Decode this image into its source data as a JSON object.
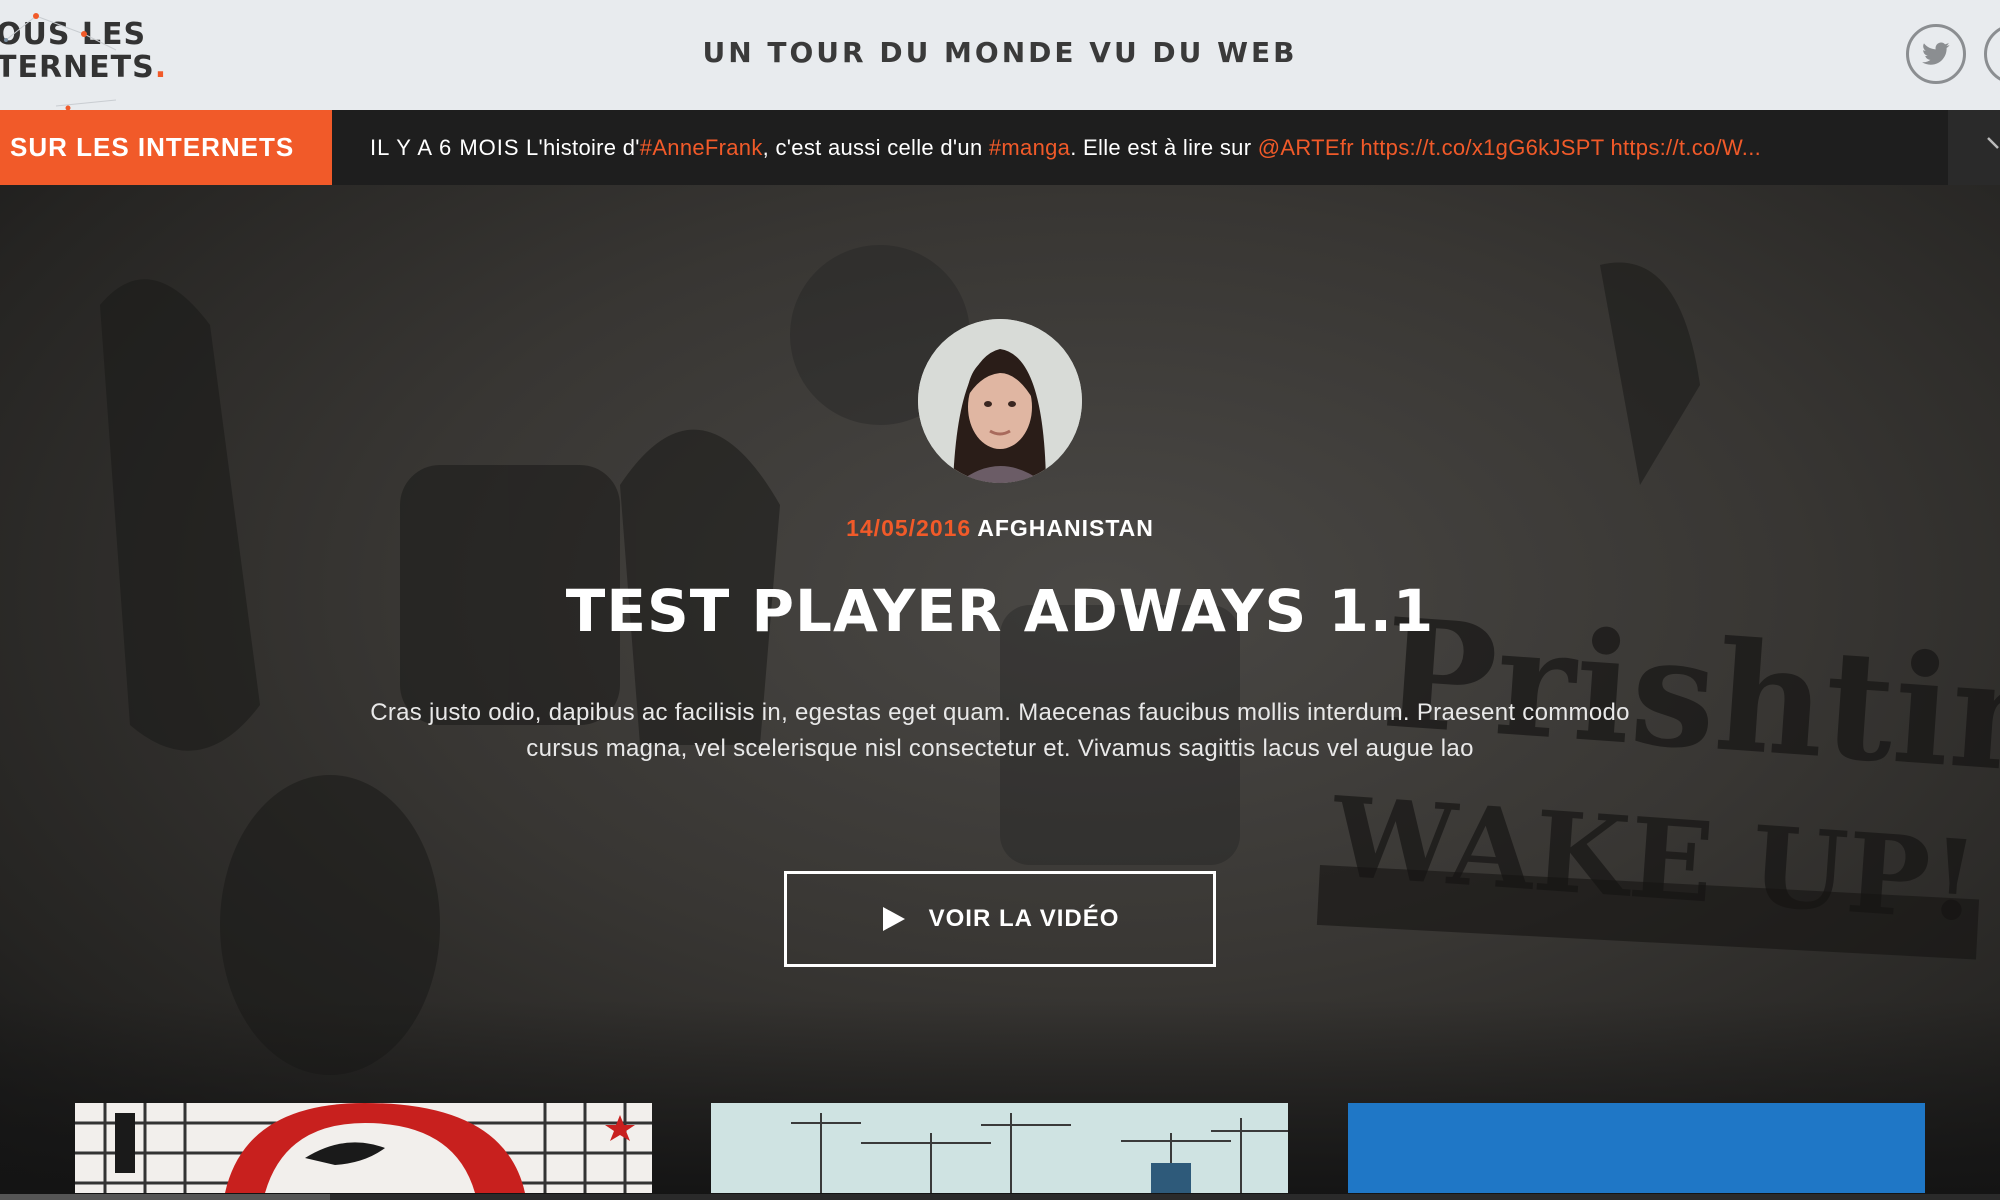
{
  "header": {
    "logo_line1": "OUS LES",
    "logo_line2": "TERNETS",
    "logo_dot": ".",
    "site_title": "UN TOUR DU MONDE VU DU WEB",
    "social_icons": [
      "twitter-icon",
      "social-icon"
    ]
  },
  "ticker": {
    "label": "SUR LES INTERNETS",
    "time": "IL Y A 6 MOIS",
    "text_1": " L'histoire d'",
    "tag_1": "#AnneFrank",
    "text_2": ", c'est aussi celle d'un ",
    "tag_2": "#manga",
    "text_3": ". Elle est à lire sur ",
    "link_1": "@ARTEfr https://t.co/x1gG6kJSPT https://t.co/W...",
    "next_icon": "chevron-right-icon"
  },
  "hero": {
    "date": "14/05/2016",
    "country": "AFGHANISTAN",
    "title": "TEST PLAYER ADWAYS 1.1",
    "description": "Cras justo odio, dapibus ac facilisis in, egestas eget quam. Maecenas faucibus mollis interdum. Praesent commodo cursus magna, vel scelerisque nisl consectetur et. Vivamus sagittis lacus vel augue lao",
    "cta_label": "VOIR LA VIDÉO",
    "cta_icon": "play-icon"
  },
  "colors": {
    "accent": "#f15a29",
    "header_bg": "#e8ebee",
    "ticker_bg": "#1e1e1e",
    "page_bg": "#141414"
  }
}
